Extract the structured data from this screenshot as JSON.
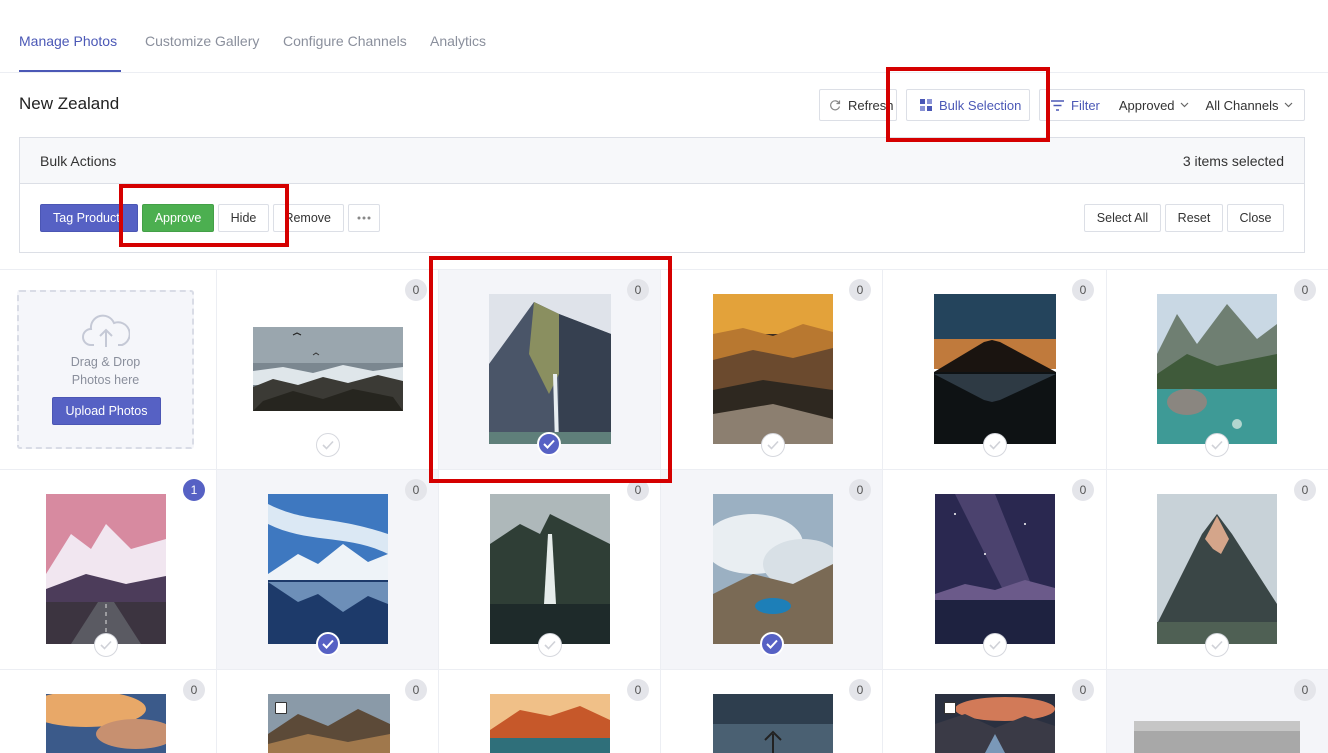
{
  "tabs": {
    "manage": "Manage Photos",
    "customize": "Customize Gallery",
    "channels": "Configure Channels",
    "analytics": "Analytics"
  },
  "page_title": "New Zealand",
  "toolbar": {
    "refresh": "Refresh",
    "bulk_selection": "Bulk Selection",
    "filter": "Filter",
    "status_select": "Approved",
    "channel_select": "All Channels"
  },
  "bulk": {
    "title": "Bulk Actions",
    "count": "3 items selected",
    "tag_product": "Tag Product",
    "approve": "Approve",
    "hide": "Hide",
    "remove": "Remove",
    "select_all": "Select All",
    "reset": "Reset",
    "close": "Close"
  },
  "upload": {
    "line1": "Drag & Drop",
    "line2": "Photos here",
    "button": "Upload Photos"
  },
  "photos": [
    {
      "badge": "0",
      "selected": false,
      "scene": "coast with seabirds"
    },
    {
      "badge": "0",
      "selected": true,
      "scene": "mitre peak waterfall"
    },
    {
      "badge": "0",
      "selected": false,
      "scene": "sunset hills"
    },
    {
      "badge": "0",
      "selected": false,
      "scene": "volcano reflection"
    },
    {
      "badge": "0",
      "selected": false,
      "scene": "alpine lake"
    },
    {
      "badge": "1",
      "selected": false,
      "scene": "road to mountains"
    },
    {
      "badge": "0",
      "selected": true,
      "scene": "snowy mountain lake"
    },
    {
      "badge": "0",
      "selected": false,
      "scene": "fiord waterfall"
    },
    {
      "badge": "0",
      "selected": true,
      "scene": "crater lake in clouds"
    },
    {
      "badge": "0",
      "selected": false,
      "scene": "milky way over lake"
    },
    {
      "badge": "0",
      "selected": false,
      "scene": "mountain peak"
    },
    {
      "badge": "0",
      "selected": false,
      "scene": "sunset clouds"
    },
    {
      "badge": "0",
      "selected": false,
      "scene": "autumn mountains"
    },
    {
      "badge": "0",
      "selected": false,
      "scene": "lake at dusk"
    },
    {
      "badge": "0",
      "selected": false,
      "scene": "lone tree"
    },
    {
      "badge": "0",
      "selected": false,
      "scene": "river valley sunset"
    },
    {
      "badge": "0",
      "selected": false,
      "scene": "misty hills"
    }
  ],
  "colors": {
    "accent": "#5661c4",
    "approve": "#4caf50",
    "highlight": "#d50000"
  }
}
